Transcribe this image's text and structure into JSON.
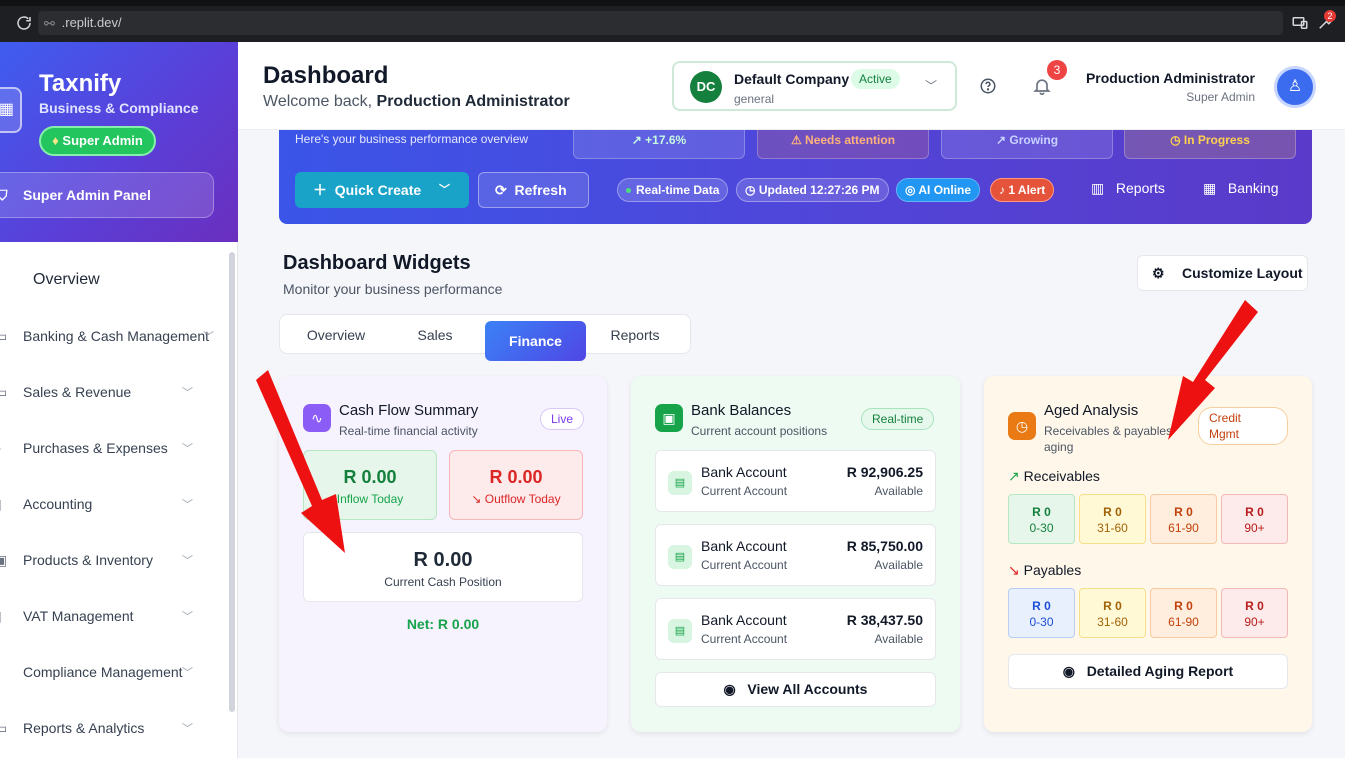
{
  "browser": {
    "url": ".replit.dev/",
    "extension_badge": "2"
  },
  "sidebar": {
    "brand": "Taxnify",
    "subtitle": "Business & Compliance",
    "role_badge": "Super Admin",
    "panel_button": "Super Admin Panel",
    "items": [
      {
        "label": "Overview",
        "icon": "chart-line-icon"
      },
      {
        "label": "Banking & Cash Management",
        "icon": "bank-icon"
      },
      {
        "label": "Sales & Revenue",
        "icon": "sales-icon"
      },
      {
        "label": "Purchases & Expenses",
        "icon": "cart-icon"
      },
      {
        "label": "Accounting",
        "icon": "calculator-icon"
      },
      {
        "label": "Products & Inventory",
        "icon": "box-icon"
      },
      {
        "label": "VAT Management",
        "icon": "receipt-icon"
      },
      {
        "label": "Compliance Management",
        "icon": "shield-icon"
      },
      {
        "label": "Reports & Analytics",
        "icon": "report-icon"
      }
    ]
  },
  "header": {
    "title": "Dashboard",
    "welcome_prefix": "Welcome back,",
    "welcome_name": "Production Administrator",
    "company": {
      "initials": "DC",
      "name": "Default Company",
      "status": "Active",
      "type": "general"
    },
    "notification_count": "3",
    "user_name": "Production Administrator",
    "user_role": "Super Admin"
  },
  "hero": {
    "text": "Here's your business performance overview",
    "stats": [
      "↗ +17.6%",
      "⚠ Needs attention",
      "↗ Growing",
      "◷ In Progress"
    ],
    "quick_create": "Quick Create",
    "refresh": "Refresh",
    "pills": [
      "Real-time Data",
      "Updated 12:27:26 PM",
      "AI Online",
      "1 Alert"
    ],
    "links": [
      "Reports",
      "Banking"
    ]
  },
  "widgets": {
    "title": "Dashboard Widgets",
    "subtitle": "Monitor your business performance",
    "customize": "Customize Layout",
    "tabs": [
      "Overview",
      "Sales",
      "Finance",
      "Reports"
    ],
    "active_tab": "Finance"
  },
  "cash_flow": {
    "title": "Cash Flow Summary",
    "subtitle": "Real-time financial activity",
    "badge": "Live",
    "inflow_value": "R 0.00",
    "inflow_label": "Inflow Today",
    "outflow_value": "R 0.00",
    "outflow_label": "Outflow Today",
    "position_value": "R 0.00",
    "position_label": "Current Cash Position",
    "net": "Net: R 0.00"
  },
  "bank_balances": {
    "title": "Bank Balances",
    "subtitle": "Current account positions",
    "badge": "Real-time",
    "accounts": [
      {
        "name": "Bank Account",
        "type": "Current Account",
        "amount": "R 92,906.25",
        "status": "Available"
      },
      {
        "name": "Bank Account",
        "type": "Current Account",
        "amount": "R 85,750.00",
        "status": "Available"
      },
      {
        "name": "Bank Account",
        "type": "Current Account",
        "amount": "R 38,437.50",
        "status": "Available"
      }
    ],
    "view_all": "View All Accounts"
  },
  "aged_analysis": {
    "title": "Aged Analysis",
    "subtitle_line1": "Receivables & payables",
    "subtitle_line2": "aging",
    "badge_line1": "Credit",
    "badge_line2": "Mgmt",
    "receivables_label": "Receivables",
    "receivables": [
      {
        "value": "R 0",
        "range": "0-30"
      },
      {
        "value": "R 0",
        "range": "31-60"
      },
      {
        "value": "R 0",
        "range": "61-90"
      },
      {
        "value": "R 0",
        "range": "90+"
      }
    ],
    "payables_label": "Payables",
    "payables": [
      {
        "value": "R 0",
        "range": "0-30"
      },
      {
        "value": "R 0",
        "range": "31-60"
      },
      {
        "value": "R 0",
        "range": "61-90"
      },
      {
        "value": "R 0",
        "range": "90+"
      }
    ],
    "report_button": "Detailed Aging Report"
  },
  "colors": {
    "accent_blue": "#3b82f6",
    "brand_purple": "#5a3fd8",
    "success": "#16a34a",
    "danger": "#dc2626",
    "annotation_red": "#ee1111"
  }
}
